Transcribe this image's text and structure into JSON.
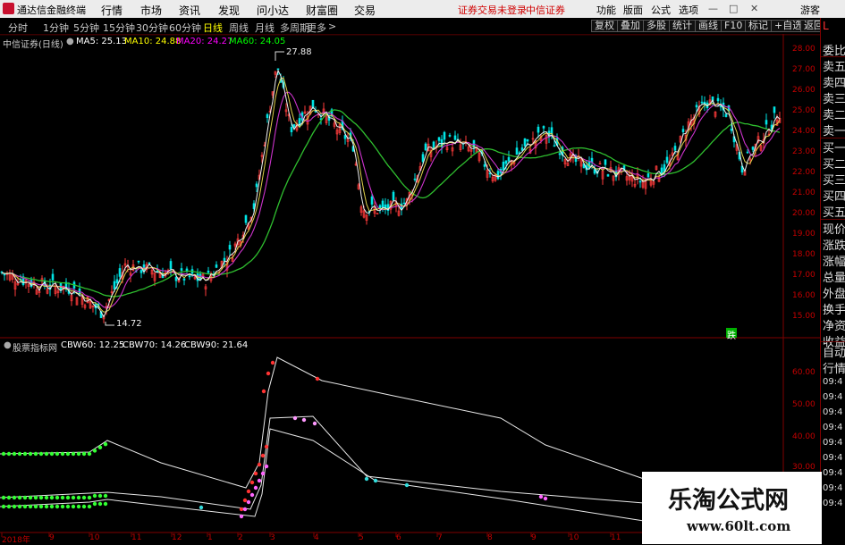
{
  "app": {
    "title": "通达信金融终端",
    "status_login": "证券交易未登录",
    "status_broker": "中信证券",
    "guest": "游客"
  },
  "menu": [
    "行情",
    "市场",
    "资讯",
    "发现",
    "问小达",
    "财富圈",
    "交易"
  ],
  "right_menu": [
    "功能",
    "版面",
    "公式",
    "选项"
  ],
  "periods": [
    "分时",
    "1分钟",
    "5分钟",
    "15分钟",
    "30分钟",
    "60分钟",
    "日线",
    "周线",
    "月线",
    "多周期",
    "更多"
  ],
  "active_period": "日线",
  "tools": [
    "复权",
    "叠加",
    "多股",
    "统计",
    "画线",
    "F10",
    "标记",
    "+自选",
    "返回"
  ],
  "main_panel": {
    "title": "中信证券(日线)",
    "ma5": "MA5: 25.13",
    "ma10": "MA10: 24.88",
    "ma20": "MA20: 24.27",
    "ma60": "MA60: 24.05",
    "high_note": "27.88",
    "low_note": "14.72",
    "event_label": "跌"
  },
  "sub_panel": {
    "title": "股票指标网",
    "cbw60": "CBW60: 12.25",
    "cbw70": "CBW70: 14.26",
    "cbw90": "CBW90: 21.64"
  },
  "right_panel": {
    "items": [
      "委比",
      "卖五",
      "卖四",
      "卖三",
      "卖二",
      "卖一",
      "买一",
      "买二",
      "买三",
      "买四",
      "买五",
      "现价",
      "涨跌",
      "涨幅",
      "总量",
      "外盘",
      "换手",
      "净资",
      "收益"
    ],
    "lower": [
      "自动",
      "行情"
    ],
    "times": [
      "09:4",
      "09:4",
      "09:4",
      "09:4",
      "09:4",
      "09:4",
      "09:4",
      "09:4",
      "09:4"
    ],
    "flag": "L"
  },
  "price_axis": [
    "28.00",
    "27.00",
    "26.00",
    "25.00",
    "24.00",
    "23.00",
    "22.00",
    "21.00",
    "20.00",
    "19.00",
    "18.00",
    "17.00",
    "16.00",
    "15.00"
  ],
  "ind_axis": [
    "60.00",
    "50.00",
    "40.00",
    "30.00"
  ],
  "x_axis": [
    "2018年",
    "9",
    "10",
    "11",
    "12",
    "1",
    "2",
    "3",
    "4",
    "5",
    "6",
    "7",
    "8",
    "9",
    "10",
    "11"
  ],
  "watermark": {
    "line1": "乐淘公式网",
    "line2": "www.60lt.com"
  },
  "colors": {
    "ma5": "#ffffff",
    "ma10": "#ffff00",
    "ma20": "#ff00ff",
    "ma60": "#00ff00",
    "up": "#ff3333",
    "down": "#00ffff",
    "axis": "#c40000"
  }
}
